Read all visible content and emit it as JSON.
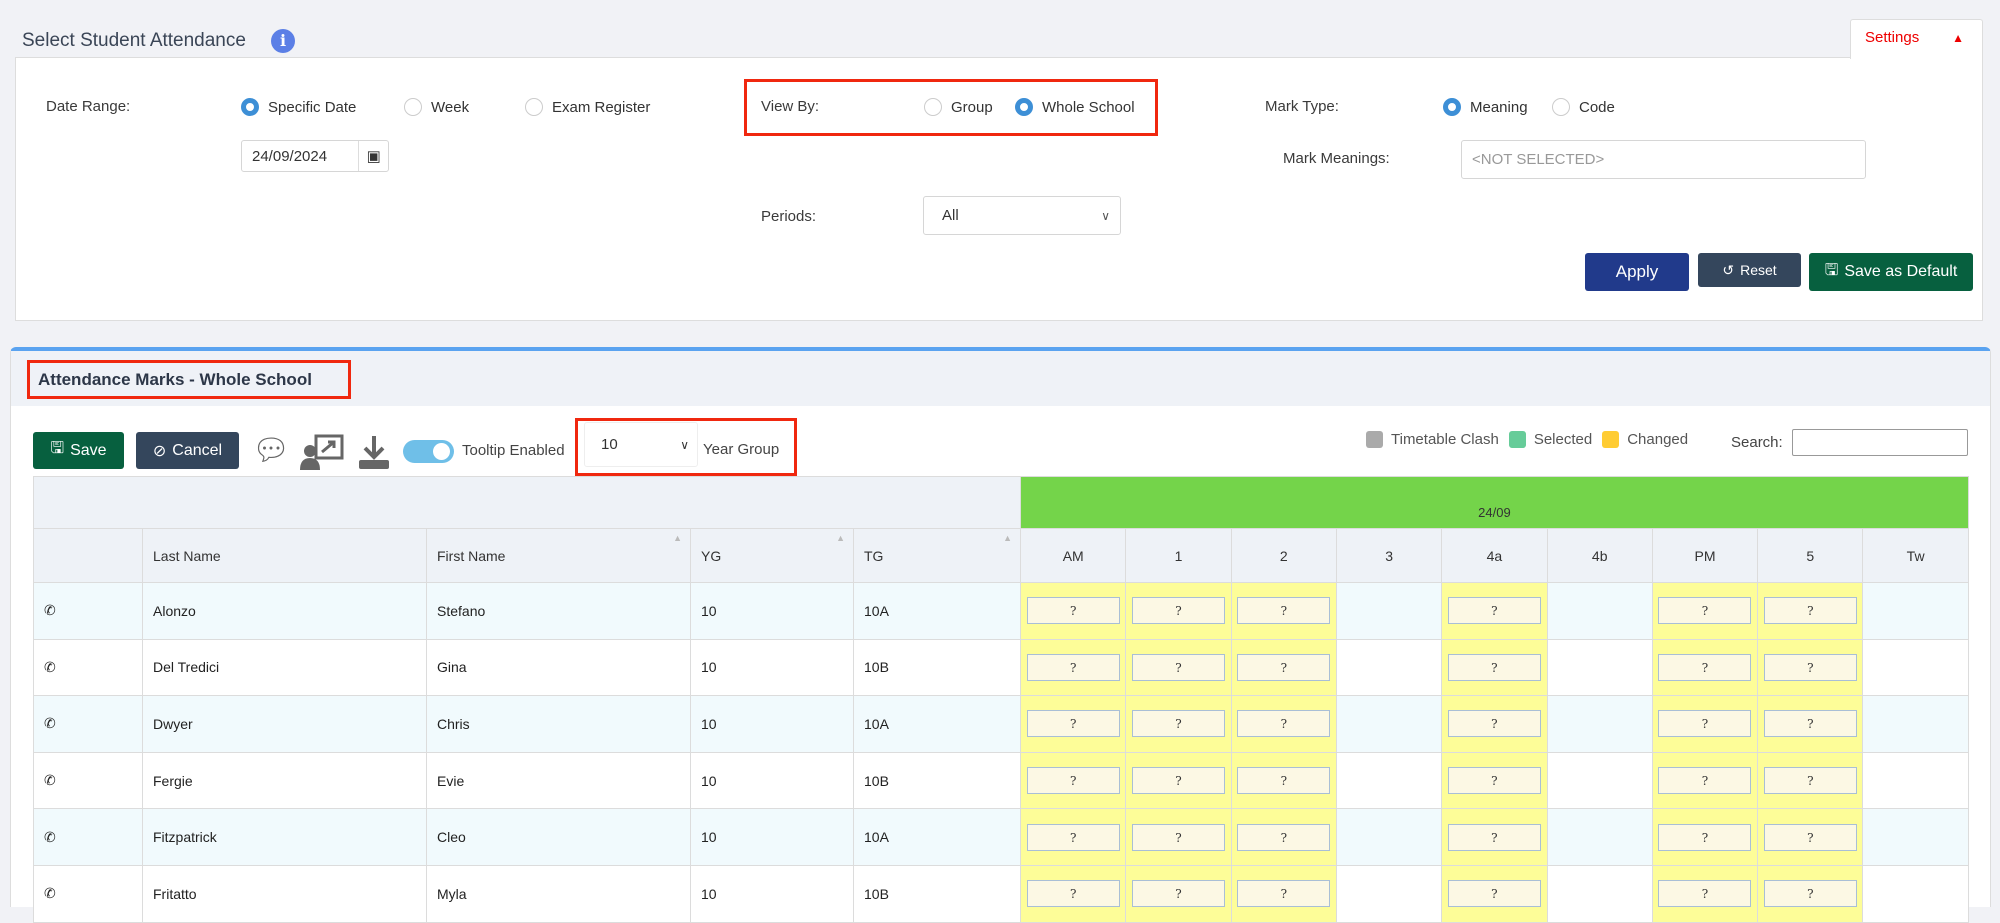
{
  "header": {
    "title": "Select Student Attendance",
    "info_icon": "info-icon",
    "settings_tab": "Settings"
  },
  "filters": {
    "date_range_label": "Date Range:",
    "date_range_options": [
      "Specific Date",
      "Week",
      "Exam Register"
    ],
    "date_range_selected": "Specific Date",
    "date_value": "24/09/2024",
    "view_by_label": "View By:",
    "view_by_options": [
      "Group",
      "Whole School"
    ],
    "view_by_selected": "Whole School",
    "periods_label": "Periods:",
    "periods_value": "All",
    "mark_type_label": "Mark Type:",
    "mark_type_options": [
      "Meaning",
      "Code"
    ],
    "mark_type_selected": "Meaning",
    "mark_meanings_label": "Mark Meanings:",
    "mark_meanings_placeholder": "<NOT SELECTED>",
    "apply": "Apply",
    "reset": "Reset",
    "save_default": "Save as Default"
  },
  "marks": {
    "title": "Attendance Marks - Whole School",
    "save": "Save",
    "cancel": "Cancel",
    "tooltip_label": "Tooltip Enabled",
    "tooltip_enabled": true,
    "year_group_value": "10",
    "year_group_label": "Year Group",
    "legend": [
      {
        "label": "Timetable Clash",
        "color": "#aaaaaa"
      },
      {
        "label": "Selected",
        "color": "#66cc99"
      },
      {
        "label": "Changed",
        "color": "#ffcc33"
      }
    ],
    "search_label": "Search:",
    "date_header": "24/09",
    "columns": [
      "Last Name",
      "First Name",
      "YG",
      "TG"
    ],
    "periods": [
      "AM",
      "1",
      "2",
      "3",
      "4a",
      "4b",
      "PM",
      "5",
      "Tw"
    ],
    "period_has_mark": [
      true,
      true,
      true,
      false,
      true,
      false,
      true,
      true,
      false
    ],
    "mark_value": "?",
    "rows": [
      {
        "last": "Alonzo",
        "first": "Stefano",
        "yg": "10",
        "tg": "10A"
      },
      {
        "last": "Del Tredici",
        "first": "Gina",
        "yg": "10",
        "tg": "10B"
      },
      {
        "last": "Dwyer",
        "first": "Chris",
        "yg": "10",
        "tg": "10A"
      },
      {
        "last": "Fergie",
        "first": "Evie",
        "yg": "10",
        "tg": "10B"
      },
      {
        "last": "Fitzpatrick",
        "first": "Cleo",
        "yg": "10",
        "tg": "10A"
      },
      {
        "last": "Fritatto",
        "first": "Myla",
        "yg": "10",
        "tg": "10B"
      }
    ]
  }
}
